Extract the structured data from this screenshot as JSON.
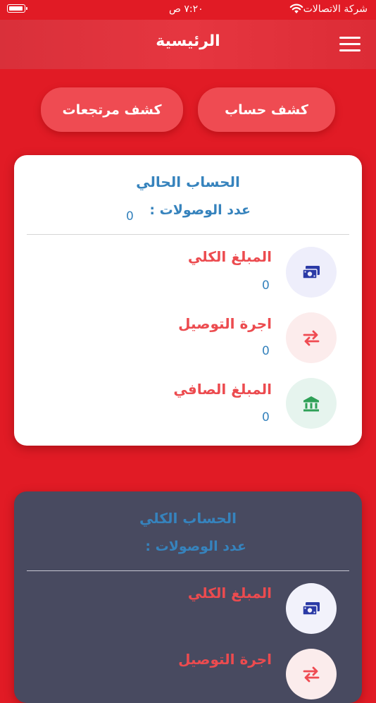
{
  "status_bar": {
    "carrier": "شركة الاتصالات",
    "time": "٧:٢٠ ص",
    "wifi_icon": "wifi-icon",
    "battery_icon": "battery-icon"
  },
  "app_bar": {
    "title": "الرئيسية",
    "menu_icon": "hamburger-menu-icon"
  },
  "actions": {
    "account_statement": "كشف حساب",
    "returns_statement": "كشف مرتجعات"
  },
  "current_account": {
    "title": "الحساب الحالي",
    "receipts_label": "عدد الوصولات :",
    "receipts_count": "0",
    "rows": [
      {
        "label": "المبلغ الكلي",
        "value": "0",
        "icon": "money-icon"
      },
      {
        "label": "اجرة التوصيل",
        "value": "0",
        "icon": "transfer-arrows-icon"
      },
      {
        "label": "المبلغ الصافي",
        "value": "0",
        "icon": "bank-icon"
      }
    ]
  },
  "total_account": {
    "title": "الحساب الكلي",
    "receipts_label": "عدد الوصولات :",
    "rows": [
      {
        "label": "المبلغ الكلي",
        "icon": "money-icon"
      },
      {
        "label": "اجرة التوصيل",
        "icon": "transfer-arrows-icon"
      }
    ]
  },
  "colors": {
    "background_red": "#e11b25",
    "button_red": "#ef4b52",
    "accent_blue": "#3683bd",
    "label_red": "#ec4b4f",
    "dark_card": "#484a60"
  }
}
